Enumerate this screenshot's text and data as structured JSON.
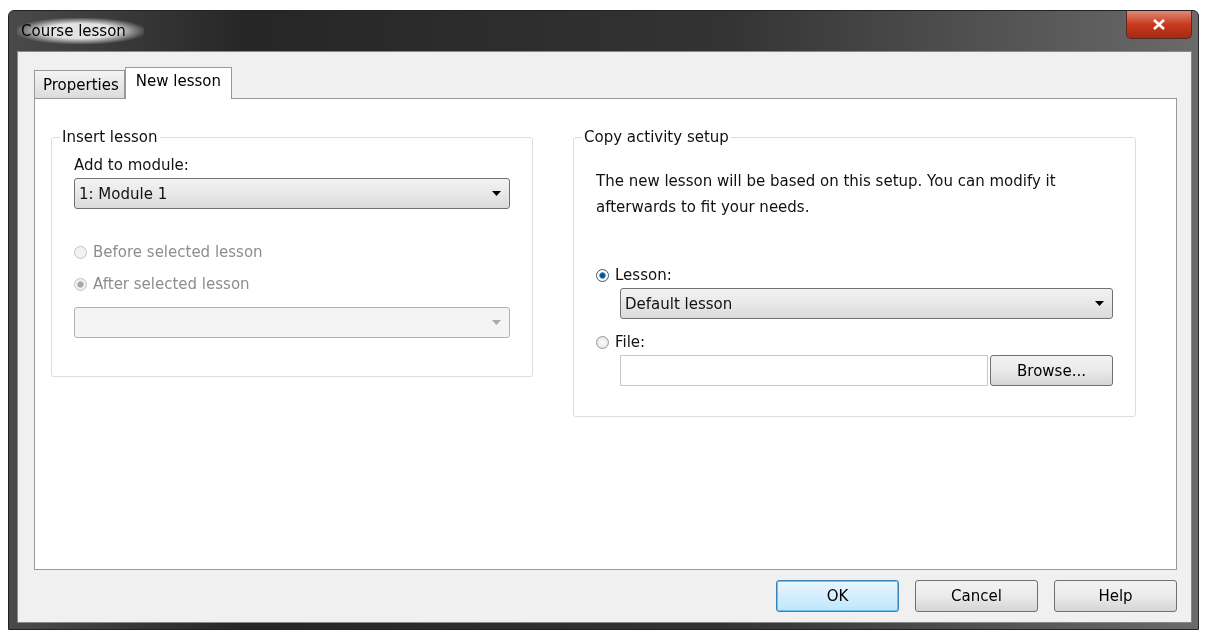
{
  "window": {
    "title": "Course lesson"
  },
  "tabs": [
    {
      "label": "Properties",
      "selected": false
    },
    {
      "label": "New lesson",
      "selected": true
    }
  ],
  "insert_lesson": {
    "title": "Insert lesson",
    "module_label": "Add to module:",
    "module_value": "1: Module 1",
    "disabled": true,
    "positions": [
      {
        "label": "Before selected lesson",
        "selected": false
      },
      {
        "label": "After selected lesson",
        "selected": true
      }
    ]
  },
  "copy_activity_setup": {
    "title": "Copy activity setup",
    "description": "The new lesson will be based on this setup. You can modify it afterwards to fit your needs.",
    "sources": [
      {
        "kind": "select",
        "label": "Lesson:",
        "selected": true,
        "value": "Default lesson"
      },
      {
        "kind": "file",
        "label": "File:",
        "selected": false,
        "button": "Browse..."
      }
    ]
  },
  "buttons": [
    {
      "label": "OK",
      "default": true
    },
    {
      "label": "Cancel",
      "default": false
    },
    {
      "label": "Help",
      "default": false
    }
  ]
}
